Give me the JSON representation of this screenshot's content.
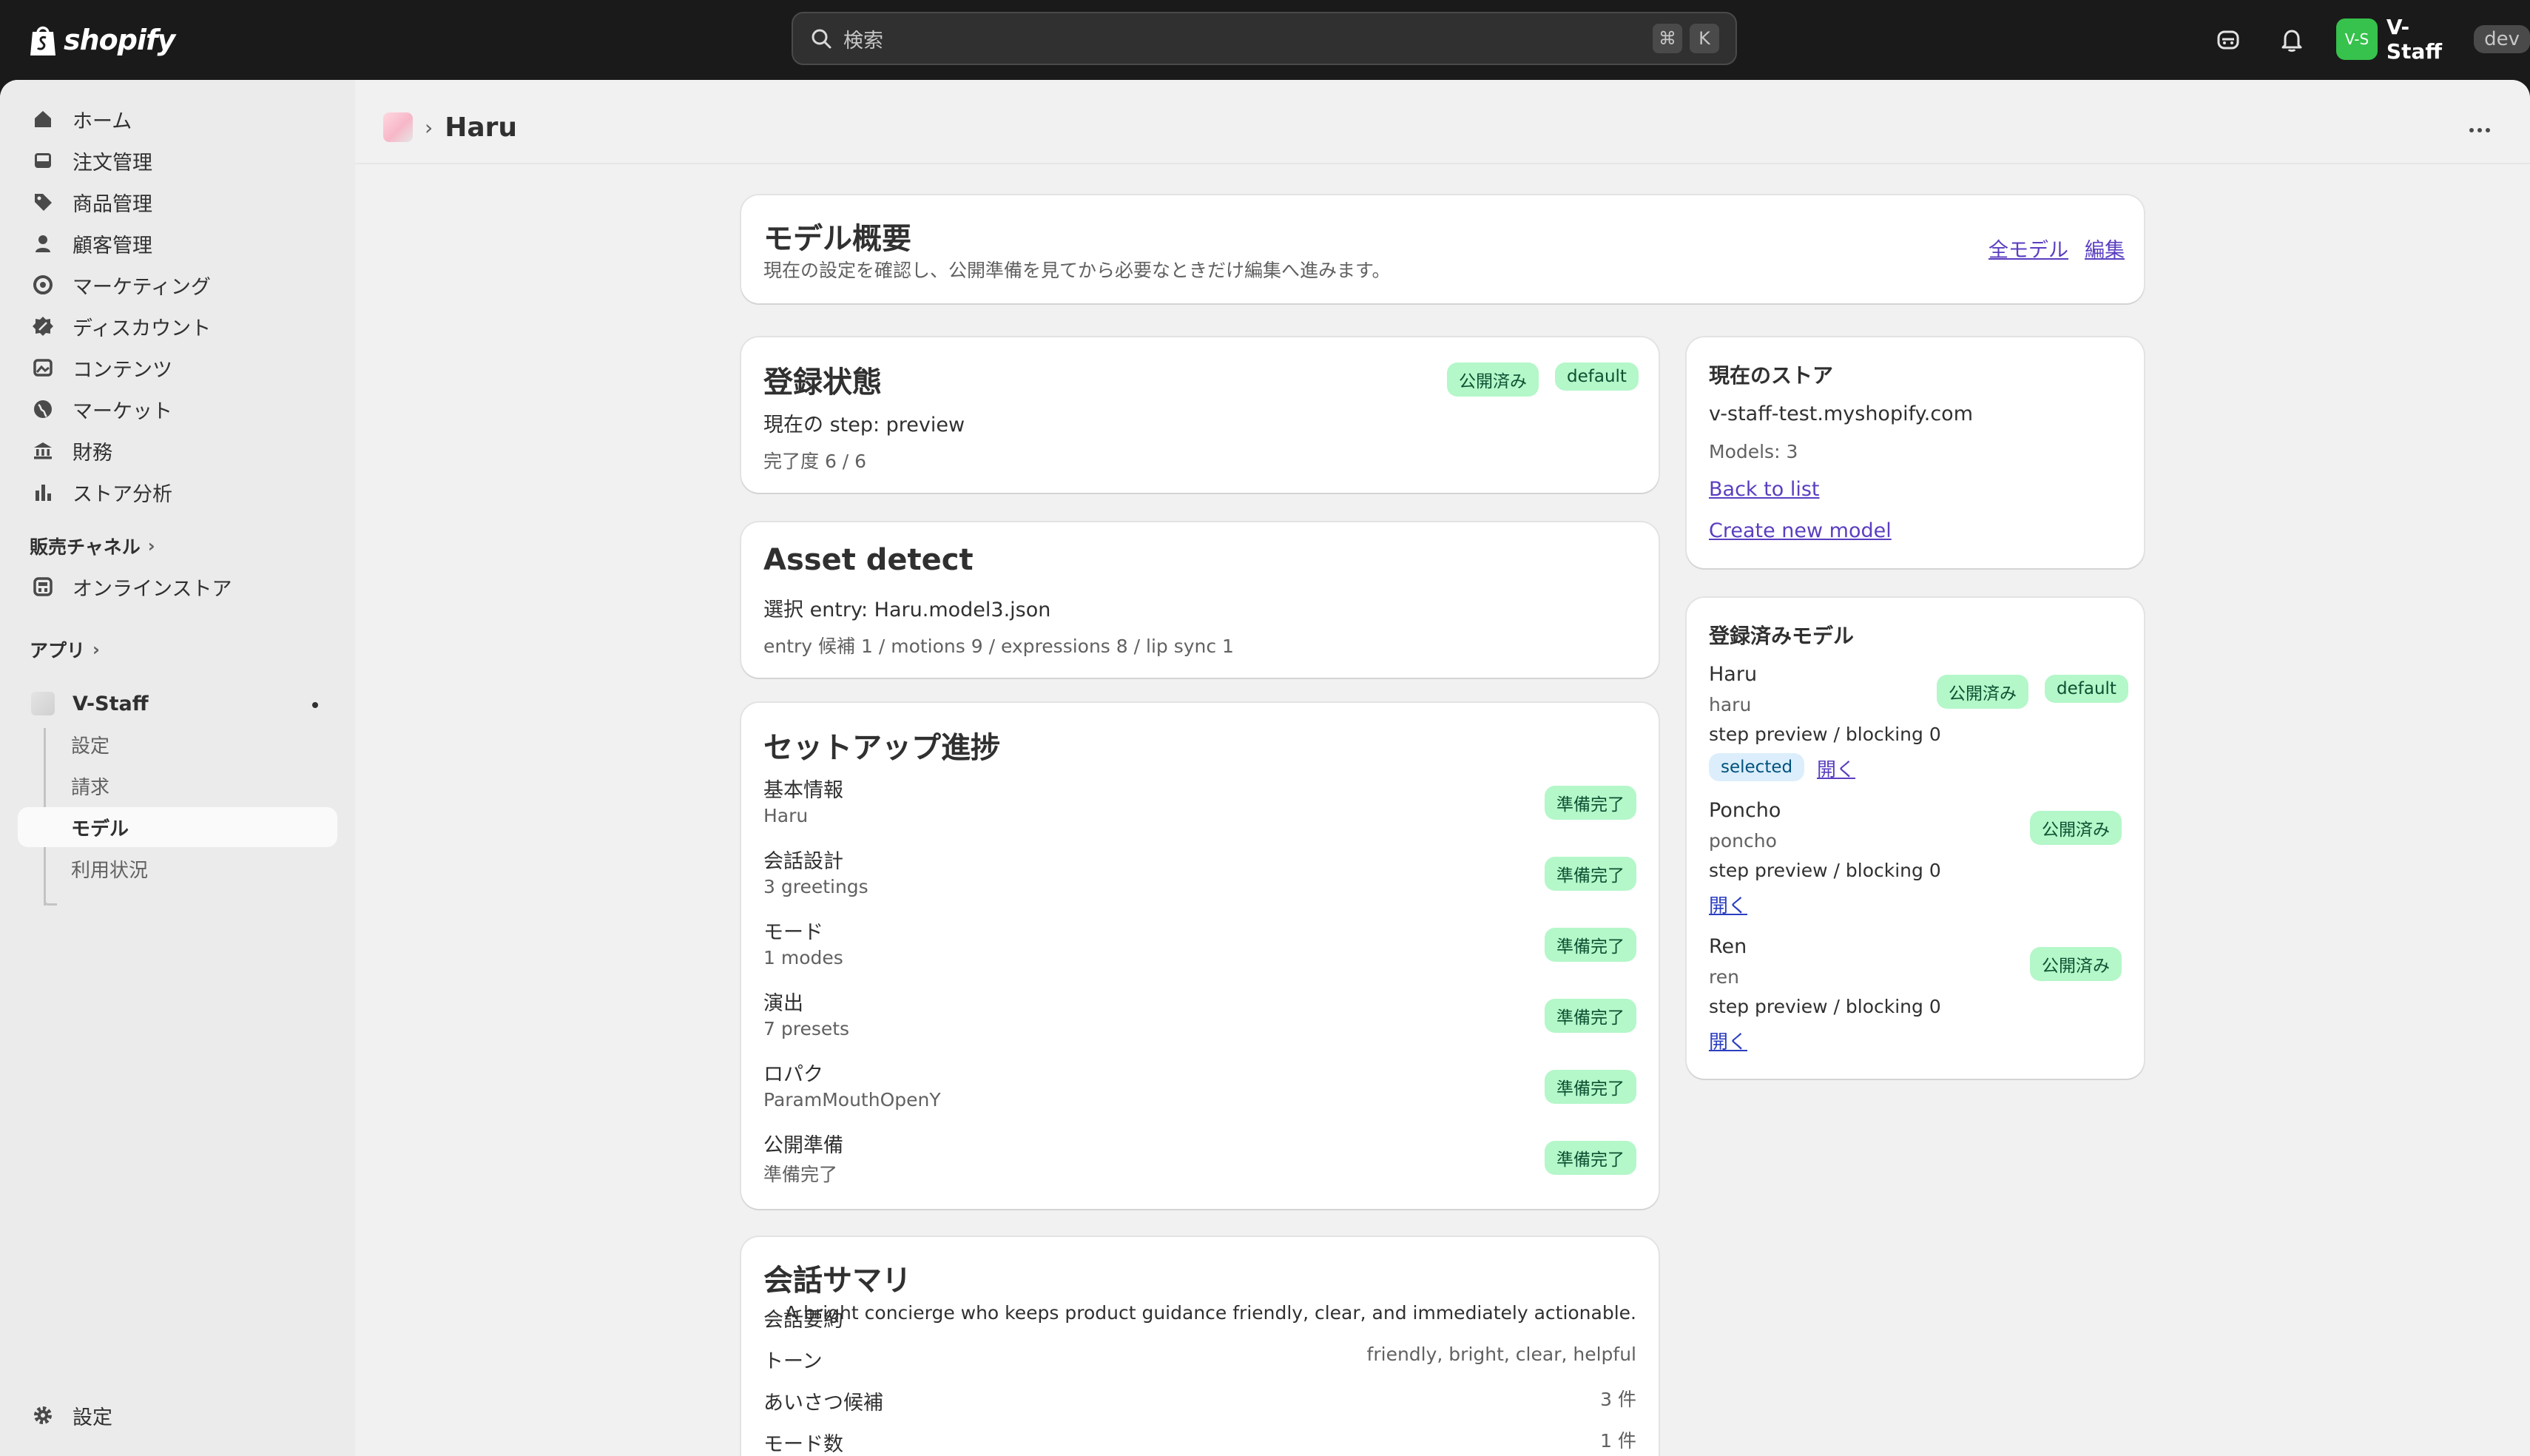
{
  "topbar": {
    "logo_text": "shopify",
    "search_placeholder": "検索",
    "kbd1": "⌘",
    "kbd2": "K",
    "user_avatar": "V-S",
    "user_name": "V-Staff",
    "dev_badge": "dev"
  },
  "sidebar": {
    "items": [
      {
        "label": "ホーム",
        "icon": "home-icon"
      },
      {
        "label": "注文管理",
        "icon": "inbox-icon"
      },
      {
        "label": "商品管理",
        "icon": "tag-icon"
      },
      {
        "label": "顧客管理",
        "icon": "person-icon"
      },
      {
        "label": "マーケティング",
        "icon": "target-icon"
      },
      {
        "label": "ディスカウント",
        "icon": "discount-icon"
      },
      {
        "label": "コンテンツ",
        "icon": "image-icon"
      },
      {
        "label": "マーケット",
        "icon": "globe-icon"
      },
      {
        "label": "財務",
        "icon": "bank-icon"
      },
      {
        "label": "ストア分析",
        "icon": "bar-chart-icon"
      }
    ],
    "sales_channels_label": "販売チャネル",
    "online_store": "オンラインストア",
    "apps_label": "アプリ",
    "app_name": "V-Staff",
    "app_sub": [
      "設定",
      "請求",
      "モデル",
      "利用状況"
    ],
    "settings": "設定"
  },
  "breadcrumb": {
    "title": "Haru"
  },
  "overview": {
    "title": "モデル概要",
    "desc": "現在の設定を確認し、公開準備を見てから必要なときだけ編集へ進みます。",
    "link_all": "全モデル",
    "link_edit": "編集"
  },
  "registration": {
    "title": "登録状態",
    "badge_published": "公開済み",
    "badge_default": "default",
    "step": "現在の step: preview",
    "completion": "完了度 6 / 6"
  },
  "asset": {
    "title": "Asset detect",
    "entry": "選択 entry: Haru.model3.json",
    "summary": "entry 候補 1 / motions 9 / expressions 8 / lip sync 1"
  },
  "setup": {
    "title": "セットアップ進捗",
    "rows": [
      {
        "label": "基本情報",
        "value": "Haru",
        "status": "準備完了"
      },
      {
        "label": "会話設計",
        "value": "3 greetings",
        "status": "準備完了"
      },
      {
        "label": "モード",
        "value": "1 modes",
        "status": "準備完了"
      },
      {
        "label": "演出",
        "value": "7 presets",
        "status": "準備完了"
      },
      {
        "label": "ロパク",
        "value": "ParamMouthOpenY",
        "status": "準備完了"
      },
      {
        "label": "公開準備",
        "value": "準備完了",
        "status": "準備完了"
      }
    ]
  },
  "conversation": {
    "title": "会話サマリ",
    "rows": [
      {
        "label": "会話要約",
        "value": "A bright concierge who keeps product guidance friendly, clear, and immediately actionable."
      },
      {
        "label": "トーン",
        "value": "friendly, bright, clear, helpful"
      },
      {
        "label": "あいさつ候補",
        "value": "3 件"
      },
      {
        "label": "モード数",
        "value": "1 件"
      }
    ]
  },
  "store": {
    "title": "現在のストア",
    "domain": "v-staff-test.myshopify.com",
    "models": "Models: 3",
    "back": "Back to list",
    "create": "Create new model"
  },
  "registered": {
    "title": "登録済みモデル",
    "models": [
      {
        "name": "Haru",
        "handle": "haru",
        "step": "step preview / blocking 0",
        "badges": [
          "公開済み",
          "default"
        ],
        "selected": "selected",
        "open": "開く"
      },
      {
        "name": "Poncho",
        "handle": "poncho",
        "step": "step preview / blocking 0",
        "badges": [
          "公開済み"
        ],
        "open": "開く"
      },
      {
        "name": "Ren",
        "handle": "ren",
        "step": "step preview / blocking 0",
        "badges": [
          "公開済み"
        ],
        "open": "開く"
      }
    ]
  }
}
